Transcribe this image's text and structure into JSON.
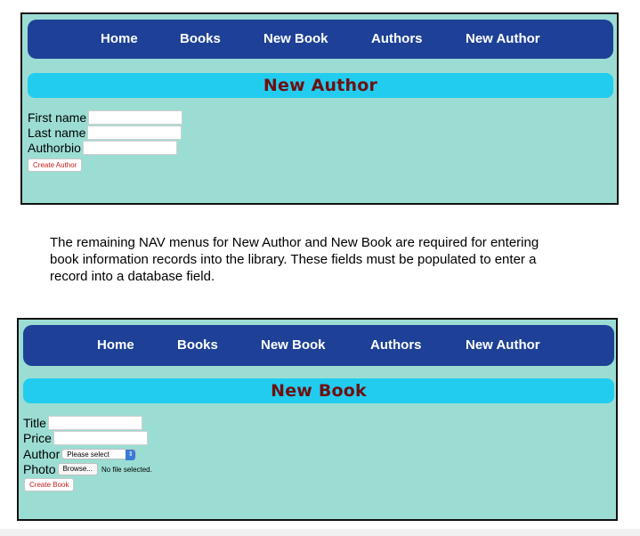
{
  "nav_items": [
    "Home",
    "Books",
    "New Book",
    "Authors",
    "New Author"
  ],
  "author_form": {
    "heading": "New Author",
    "labels": [
      "First name",
      "Last name",
      "Authorbio"
    ],
    "submit_label": "Create Author"
  },
  "description": "The remaining NAV menus for New Author and New Book are required for entering book information records into the library.  These fields must be populated to enter a record into a database field.",
  "book_form": {
    "heading": "New Book",
    "title_label": "Title",
    "price_label": "Price",
    "author_label": "Author",
    "author_select_value": "Please select",
    "photo_label": "Photo",
    "browse_label": "Browse...",
    "file_status": "No file selected.",
    "submit_label": "Create Book"
  },
  "colors": {
    "panel_bg": "#9cddd3",
    "nav_bg": "#1e4197",
    "banner_bg": "#22ccef",
    "heading_text": "#6d1010",
    "button_text": "#c52020"
  }
}
